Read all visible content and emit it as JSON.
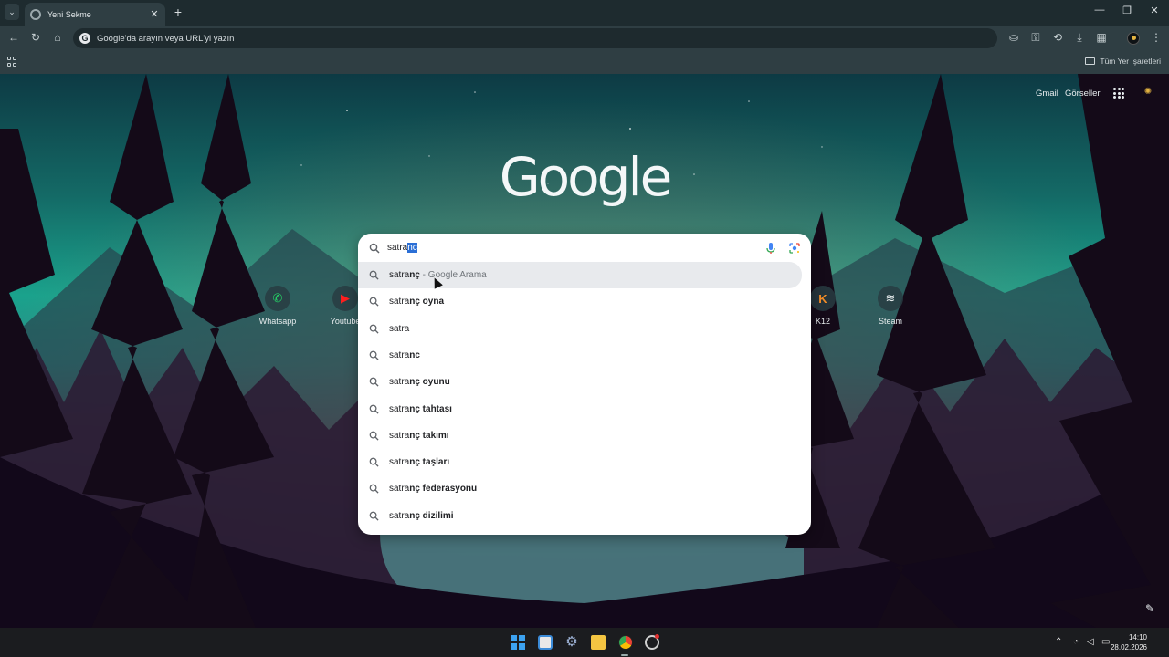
{
  "browser": {
    "tab_title": "Yeni Sekme",
    "tab_close": "✕",
    "new_tab": "+",
    "omnibox_badge": "G",
    "omnibox_placeholder": "Google'da arayın veya URL'yi yazın",
    "all_bookmarks": "Tüm Yer İşaretleri",
    "window_controls": [
      "—",
      "❐",
      "✕"
    ]
  },
  "page": {
    "logo": "Google",
    "top_links": [
      "Gmail",
      "Görseller"
    ],
    "search": {
      "typed": "satra",
      "autocomplete_selected": "nc",
      "suggestions": [
        {
          "typed": "satra",
          "rest": "nç",
          "suffix": " - Google Arama"
        },
        {
          "typed": "satra",
          "rest": "nç oyna",
          "suffix": ""
        },
        {
          "typed": "satra",
          "rest": "",
          "suffix": ""
        },
        {
          "typed": "satra",
          "rest": "nc",
          "suffix": ""
        },
        {
          "typed": "satra",
          "rest": "nç oyunu",
          "suffix": ""
        },
        {
          "typed": "satra",
          "rest": "nç tahtası",
          "suffix": ""
        },
        {
          "typed": "satra",
          "rest": "nç takımı",
          "suffix": ""
        },
        {
          "typed": "satra",
          "rest": "nç taşları",
          "suffix": ""
        },
        {
          "typed": "satra",
          "rest": "nç federasyonu",
          "suffix": ""
        },
        {
          "typed": "satra",
          "rest": "nç dizilimi",
          "suffix": ""
        }
      ]
    },
    "shortcuts": [
      {
        "label": "Whatsapp",
        "icon": "whatsapp-icon",
        "glyph": "✆",
        "color": "#25d366"
      },
      {
        "label": "Youtube",
        "icon": "youtube-icon",
        "glyph": "▶",
        "color": "#ff1f1f"
      },
      {
        "label": "K12",
        "icon": "k12-icon",
        "glyph": "K",
        "color": "#f28c28"
      },
      {
        "label": "Steam",
        "icon": "steam-icon",
        "glyph": "≋",
        "color": "#e7ecee"
      }
    ]
  },
  "taskbar": {
    "time": "14:10",
    "date": "28.02.2026"
  },
  "colors": {
    "chrome_dark": "#1e2b2f",
    "chrome_mid": "#2f3e43",
    "selection": "#2b6fd6",
    "suggestion_hover": "#e8eaed"
  }
}
